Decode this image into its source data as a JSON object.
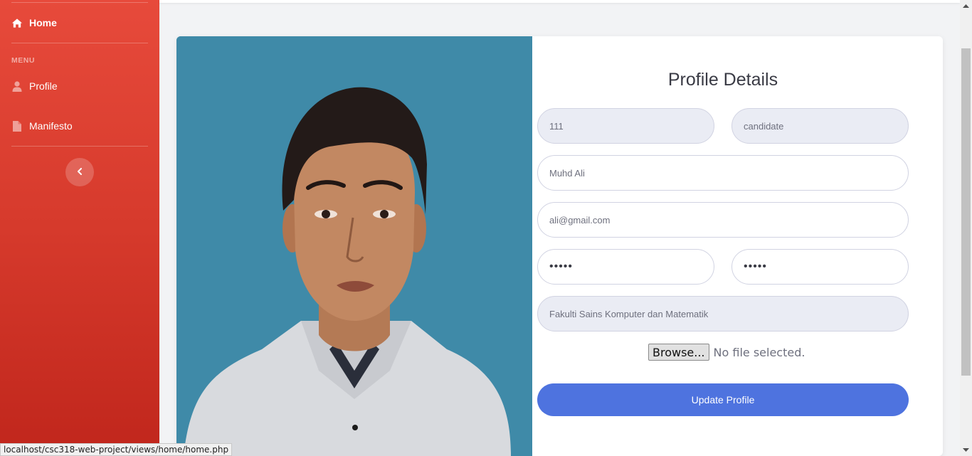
{
  "sidebar": {
    "home_label": "Home",
    "menu_heading": "MENU",
    "items": [
      {
        "label": "Profile",
        "icon": "user-icon"
      },
      {
        "label": "Manifesto",
        "icon": "file-icon"
      }
    ],
    "toggle_icon": "chevron-left-icon"
  },
  "profile": {
    "title": "Profile Details",
    "user_id": "111",
    "role": "candidate",
    "name": "Muhd Ali",
    "email": "ali@gmail.com",
    "password": "•••••",
    "password_confirm": "•••••",
    "faculty": "Fakulti Sains Komputer dan Matematik",
    "browse_label": "Browse...",
    "file_status": "No file selected.",
    "update_label": "Update Profile"
  },
  "status_url": "localhost/csc318-web-project/views/home/home.php",
  "colors": {
    "sidebar": "#e74a3b",
    "primary": "#4e73df",
    "photo_bg": "#3f8aa8"
  }
}
